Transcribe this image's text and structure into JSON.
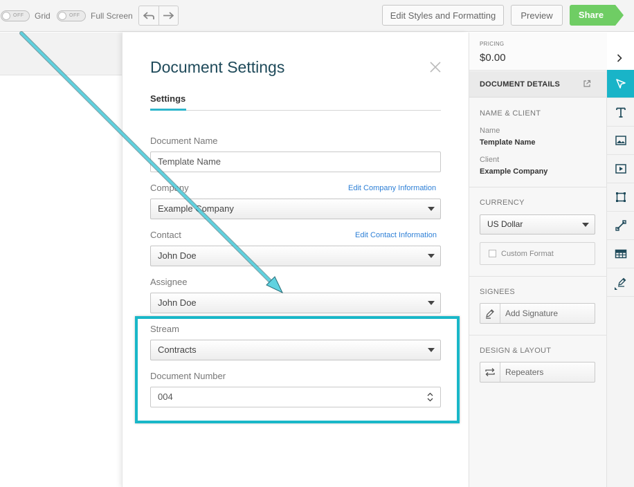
{
  "toolbar": {
    "grid_toggle_state": "OFF",
    "grid_label": "Grid",
    "fullscreen_toggle_state": "OFF",
    "fullscreen_label": "Full Screen",
    "edit_styles_label": "Edit Styles and Formatting",
    "preview_label": "Preview",
    "share_label": "Share"
  },
  "modal": {
    "title": "Document Settings",
    "tab": "Settings",
    "fields": {
      "document_name_label": "Document Name",
      "document_name_value": "Template Name",
      "company_label": "Company",
      "company_link": "Edit Company Information",
      "company_value": "Example Company",
      "contact_label": "Contact",
      "contact_link": "Edit Contact Information",
      "contact_value": "John Doe",
      "assignee_label": "Assignee",
      "assignee_value": "John Doe",
      "stream_label": "Stream",
      "stream_value": "Contracts",
      "document_number_label": "Document Number",
      "document_number_value": "004"
    }
  },
  "right_panel": {
    "pricing_label": "PRICING",
    "pricing_value": "$0.00",
    "document_details": "DOCUMENT DETAILS",
    "name_client_header": "NAME & CLIENT",
    "name_key": "Name",
    "name_value": "Template Name",
    "client_key": "Client",
    "client_value": "Example Company",
    "currency_header": "CURRENCY",
    "currency_value": "US Dollar",
    "custom_format_label": "Custom Format",
    "signees_header": "SIGNEES",
    "add_signature_label": "Add Signature",
    "design_layout_header": "DESIGN & LAYOUT",
    "repeaters_label": "Repeaters"
  },
  "tools": [
    "pointer-icon",
    "text-icon",
    "image-icon",
    "video-icon",
    "shape-icon",
    "line-icon",
    "table-icon",
    "signature-icon"
  ],
  "colors": {
    "accent": "#19b4c8",
    "share_green": "#6fcd64",
    "title_color": "#1f4a5a",
    "link_blue": "#2d7fd6"
  }
}
